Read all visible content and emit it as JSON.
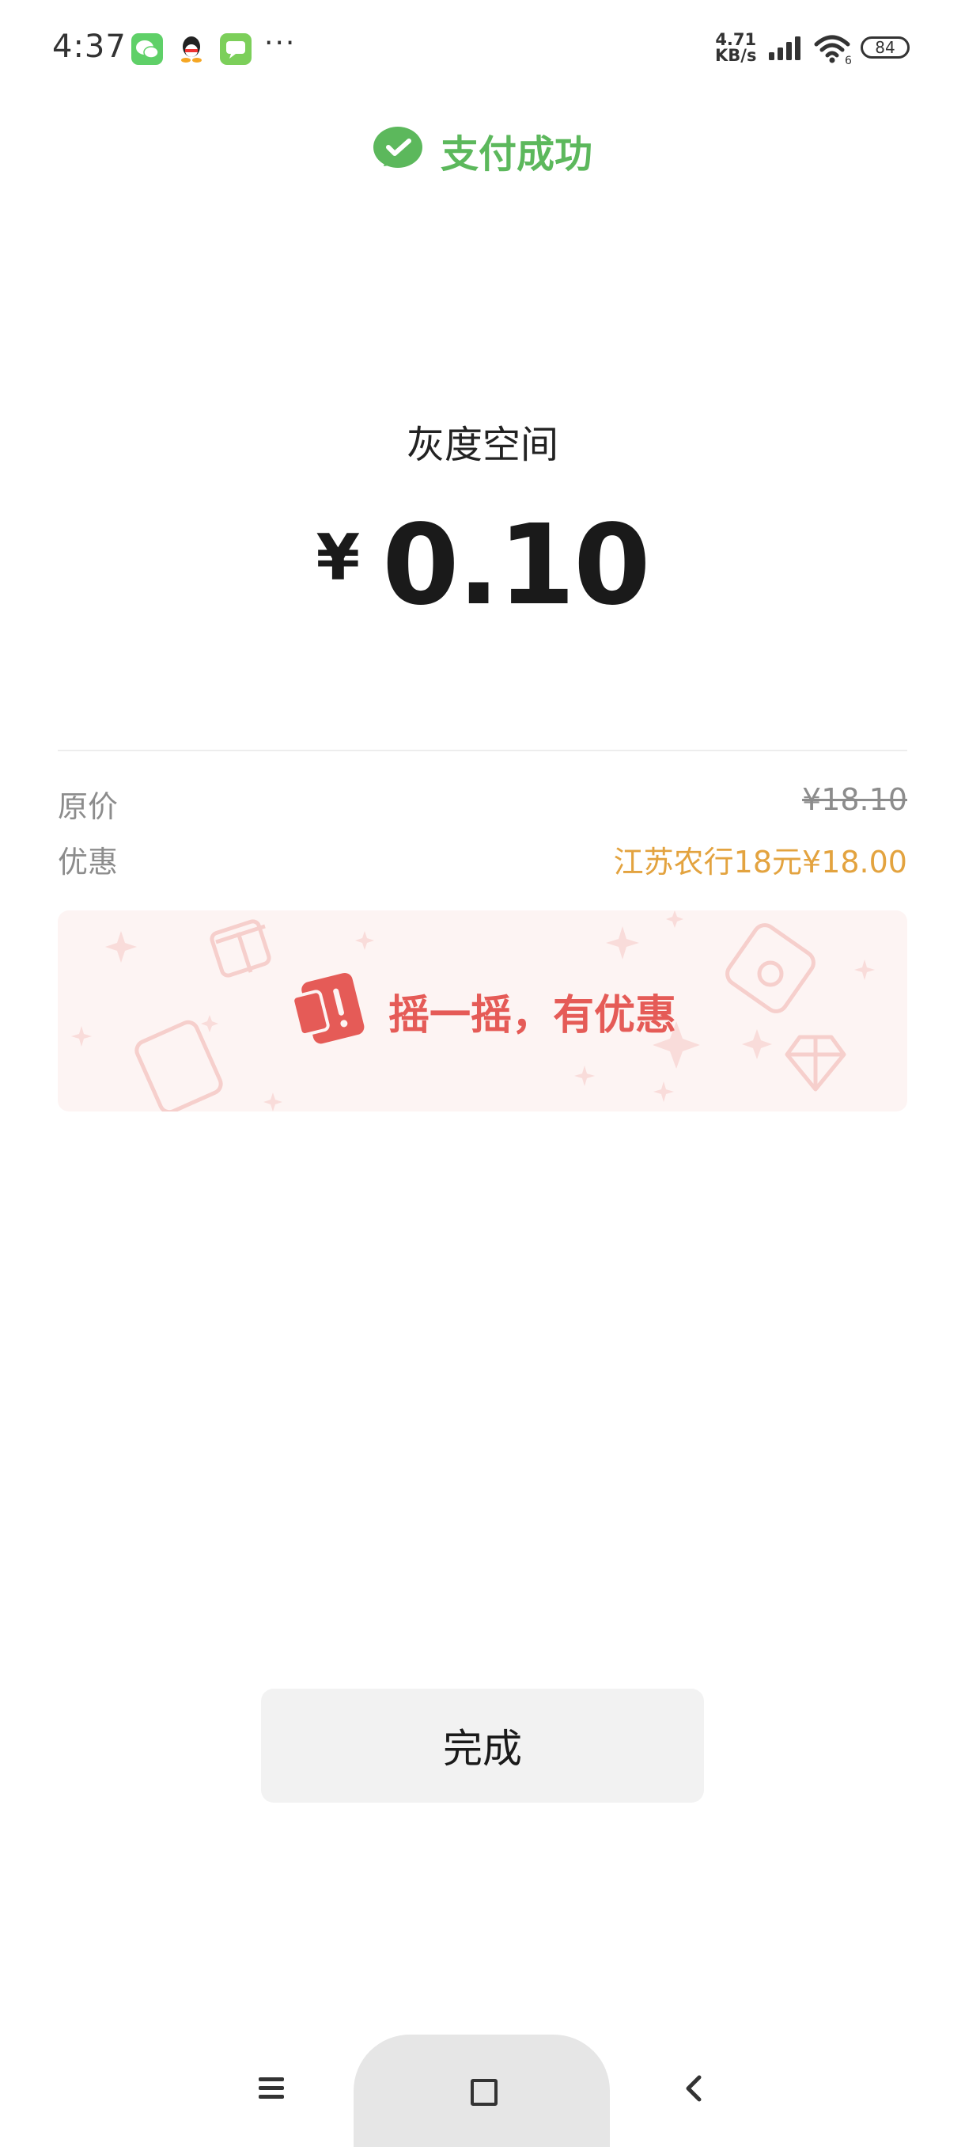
{
  "status_bar": {
    "time": "4:37",
    "dots": "···",
    "net_speed_value": "4.71",
    "net_speed_unit": "KB/s",
    "battery": "84"
  },
  "header": {
    "title": "支付成功",
    "accent": "#5cb85c"
  },
  "payment": {
    "merchant": "灰度空间",
    "currency": "¥",
    "amount": "0.10"
  },
  "details": [
    {
      "label": "原价",
      "value": "¥18.10"
    },
    {
      "label": "优惠",
      "value": "江苏农行18元¥18.00"
    }
  ],
  "promo": {
    "text": "摇一摇，有优惠",
    "color": "#e55b57"
  },
  "done_button": {
    "label": "完成"
  },
  "nav_bar": {
    "icons": [
      "menu-icon",
      "home-icon",
      "back-icon"
    ]
  }
}
